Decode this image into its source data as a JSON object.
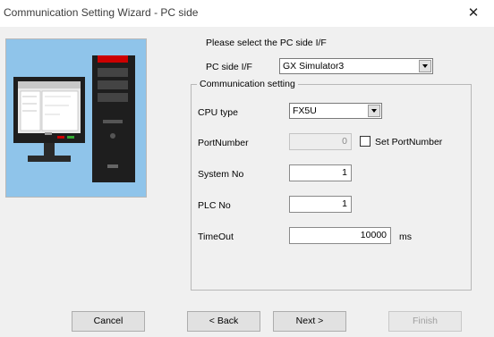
{
  "window": {
    "title": "Communication Setting Wizard - PC side",
    "close_glyph": "✕"
  },
  "prompt": "Please select the PC side I/F",
  "pc_side_if": {
    "label": "PC side I/F",
    "value": "GX Simulator3"
  },
  "comm": {
    "title": "Communication setting",
    "cpu_type": {
      "label": "CPU type",
      "value": "FX5U"
    },
    "port": {
      "label": "PortNumber",
      "value": "0",
      "set_label": "Set PortNumber"
    },
    "system_no": {
      "label": "System No",
      "value": "1"
    },
    "plc_no": {
      "label": "PLC No",
      "value": "1"
    },
    "timeout": {
      "label": "TimeOut",
      "value": "10000",
      "unit": "ms"
    }
  },
  "buttons": {
    "cancel": "Cancel",
    "back": "< Back",
    "next": "Next >",
    "finish": "Finish"
  }
}
